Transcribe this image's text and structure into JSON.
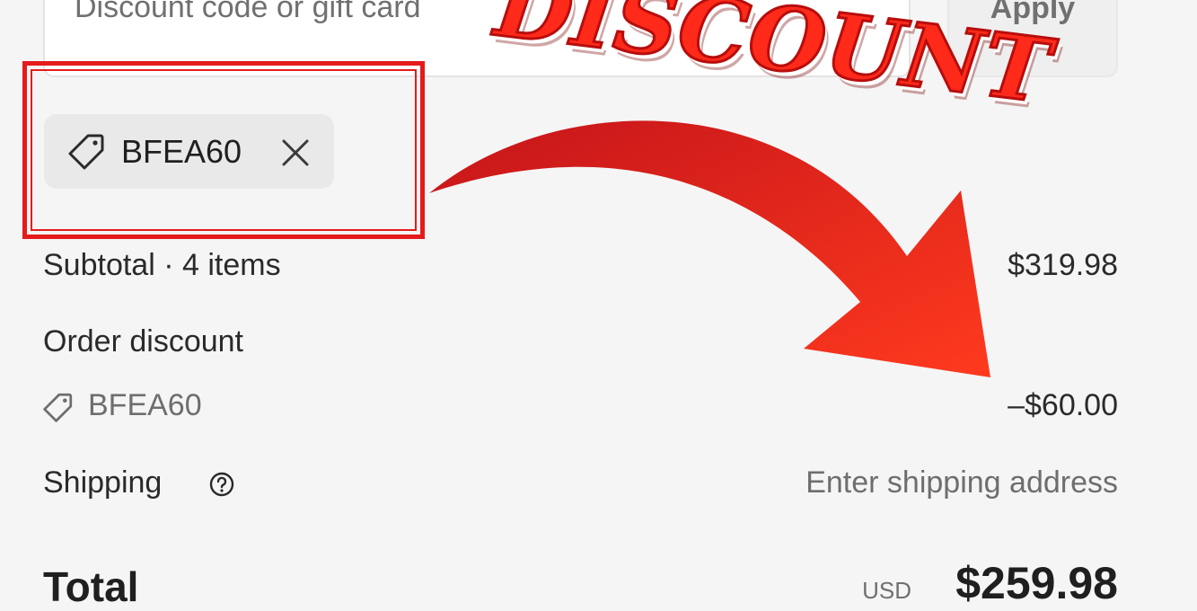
{
  "discount_field": {
    "placeholder": "Discount code or gift card",
    "apply_label": "Apply"
  },
  "applied_code": {
    "code": "BFEA60"
  },
  "summary": {
    "subtotal_label": "Subtotal · 4 items",
    "subtotal_value": "$319.98",
    "discount_label": "Order discount",
    "discount_code": "BFEA60",
    "discount_value": "–$60.00",
    "shipping_label": "Shipping",
    "shipping_value": "Enter shipping address",
    "total_label": "Total",
    "total_currency": "USD",
    "total_value": "$259.98"
  },
  "overlay": {
    "headline": "DISCOUNT",
    "highlight_color": "#e51b1b",
    "arrow_color": "#f0291c"
  }
}
